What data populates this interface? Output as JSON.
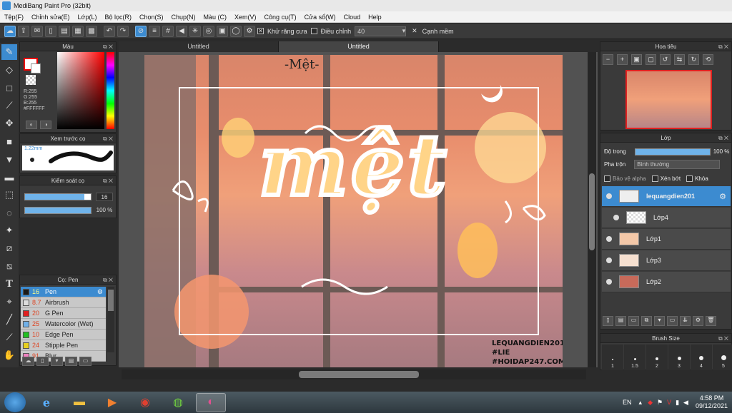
{
  "window": {
    "title": "MediBang Paint Pro (32bit)"
  },
  "menu": [
    "Tệp(F)",
    "Chỉnh sửa(E)",
    "Lớp(L)",
    "Bộ lọc(R)",
    "Chọn(S)",
    "Chụp(N)",
    "Màu (C)",
    "Xem(V)",
    "Công cụ(T)",
    "Cửa sổ(W)",
    "Cloud",
    "Help"
  ],
  "toolbar": {
    "antialias_label": "Khử răng cưa",
    "antialias_checked": true,
    "adjust_label": "Điều chỉnh",
    "adjust_value": "40",
    "sharp_edge_label": "Cạnh mềm"
  },
  "color_panel": {
    "title": "Màu",
    "r": "R:255",
    "g": "G:255",
    "b": "B:255",
    "hex": "#FFFFFF",
    "fg_color": "#ffffff",
    "fg_border": "#e00000"
  },
  "preview_panel": {
    "title": "Xem trước cọ",
    "size": "1.22mm"
  },
  "control_panel": {
    "title": "Kiểm soát cọ",
    "size_value": "16",
    "size_fraction": 0.9,
    "opacity_value": "100 %",
    "opacity_fraction": 1.0
  },
  "brush_panel": {
    "title": "Cọ: Pen",
    "brushes": [
      {
        "size": "16",
        "name": "Pen",
        "color": "#1a1a1a",
        "selected": true
      },
      {
        "size": "8.7",
        "name": "Airbrush",
        "color": "#dddddd",
        "selected": false
      },
      {
        "size": "20",
        "name": "G Pen",
        "color": "#e02020",
        "selected": false
      },
      {
        "size": "25",
        "name": "Watercolor (Wet)",
        "color": "#70b0e8",
        "selected": false
      },
      {
        "size": "10",
        "name": "Edge Pen",
        "color": "#20c020",
        "selected": false
      },
      {
        "size": "24",
        "name": "Stipple Pen",
        "color": "#e8d020",
        "selected": false
      },
      {
        "size": "91",
        "name": "Blur",
        "color": "#f080c0",
        "selected": false
      }
    ]
  },
  "document_tabs": [
    "Untitled",
    "Untitled"
  ],
  "canvas": {
    "top_text": "-Mệt-",
    "main_text": "mệt",
    "watermark": [
      "LEQUANGDIEN201",
      "#LIE",
      "#HOIDAP247.COM"
    ]
  },
  "navigator_panel": {
    "title": "Hoa tiêu"
  },
  "layer_panel": {
    "title": "Lớp",
    "opacity_label": "Độ trong",
    "opacity_value": "100 %",
    "opacity_fraction": 1.0,
    "blend_label": "Pha trộn",
    "blend_value": "Bình thường",
    "protect_alpha_label": "Bảo vệ alpha",
    "clipping_label": "Xén bớt",
    "lock_label": "Khóa",
    "layers": [
      {
        "name": "lequangdien201",
        "selected": true
      },
      {
        "name": "Lớp4",
        "selected": false
      },
      {
        "name": "Lớp1",
        "selected": false
      },
      {
        "name": "Lớp3",
        "selected": false
      },
      {
        "name": "Lớp2",
        "selected": false
      }
    ]
  },
  "brush_size_panel": {
    "title": "Brush Size",
    "sizes": [
      "1",
      "1.5",
      "2",
      "3",
      "4",
      "5"
    ]
  },
  "taskbar": {
    "language": "EN",
    "time": "4:58 PM",
    "date": "09/12/2021"
  }
}
